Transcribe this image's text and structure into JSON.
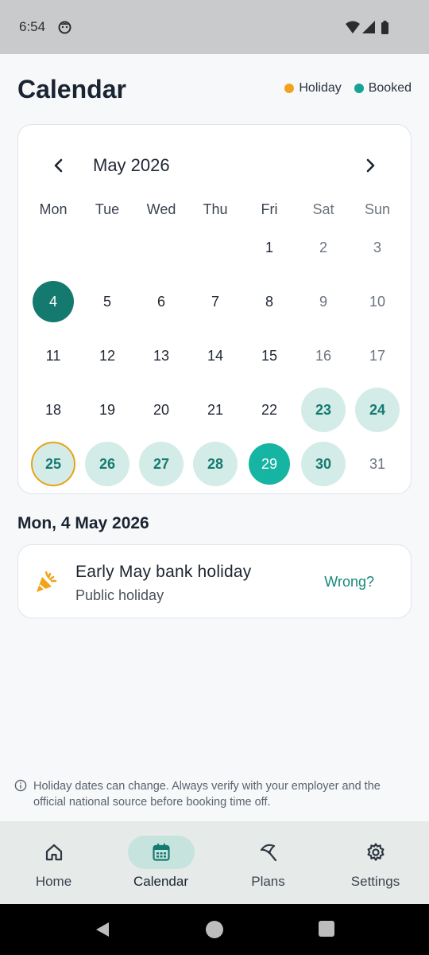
{
  "status": {
    "time": "6:54"
  },
  "header": {
    "title": "Calendar"
  },
  "legend": [
    {
      "label": "Holiday",
      "color": "#f2a31b"
    },
    {
      "label": "Booked",
      "color": "#16a394"
    }
  ],
  "calendar": {
    "month_label": "May 2026",
    "weekdays": [
      "Mon",
      "Tue",
      "Wed",
      "Thu",
      "Fri",
      "Sat",
      "Sun"
    ],
    "first_weekday_index": 4,
    "days_in_month": 31,
    "selected_day": 4,
    "today_day": 29,
    "booked_days": [
      23,
      24,
      25,
      26,
      27,
      28,
      29,
      30
    ],
    "holiday_days": [
      25
    ]
  },
  "selected": {
    "date_label": "Mon, 4 May 2026",
    "event": {
      "name": "Early May bank holiday",
      "type": "Public holiday",
      "action_label": "Wrong?",
      "icon": "party-popper-icon"
    }
  },
  "disclaimer": "Holiday dates can change. Always verify with your employer and the official national source before booking time off.",
  "bottom_nav": [
    {
      "label": "Home",
      "icon": "home-icon",
      "active": false
    },
    {
      "label": "Calendar",
      "icon": "calendar-icon",
      "active": true
    },
    {
      "label": "Plans",
      "icon": "beach-umbrella-icon",
      "active": false
    },
    {
      "label": "Settings",
      "icon": "gear-icon",
      "active": false
    }
  ],
  "colors": {
    "accent": "#147a6f",
    "booked_bg": "#d4ece7",
    "today": "#16b4a3",
    "holiday": "#e8a317"
  }
}
